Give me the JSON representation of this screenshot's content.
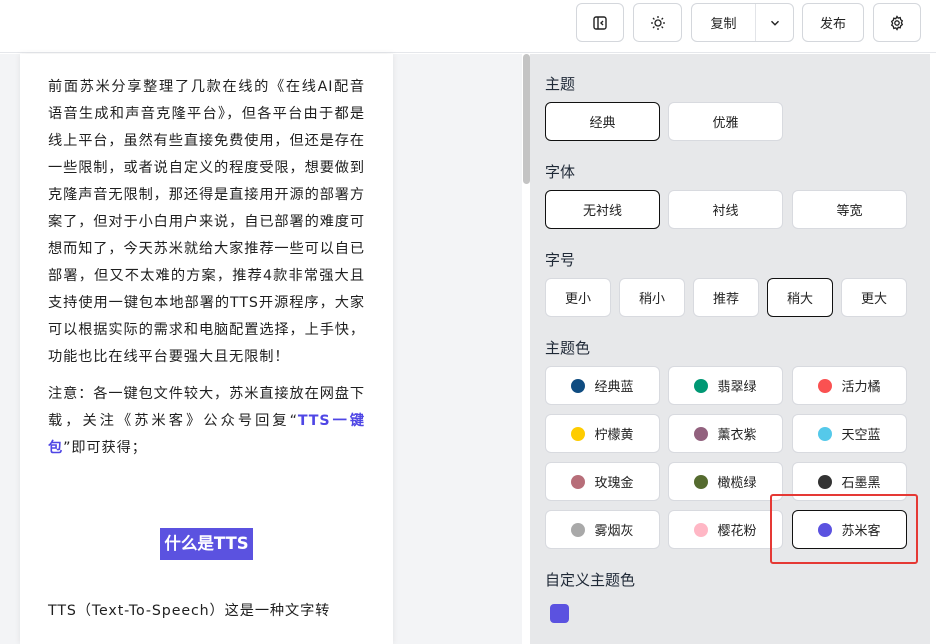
{
  "toolbar": {
    "copy_label": "复制",
    "publish_label": "发布",
    "icons": [
      "sidebar-toggle-icon",
      "sun-icon",
      "chevron-down-icon",
      "gear-icon"
    ]
  },
  "article": {
    "para1": "前面苏米分享整理了几款在线的《在线AI配音语音生成和声音克隆平台》，但各平台由于都是线上平台，虽然有些直接免费使用，但还是存在一些限制，或者说自定义的程度受限，想要做到克隆声音无限制，那还得是直接用开源的部署方案了，但对于小白用户来说，自已部署的难度可想而知了，今天苏米就给大家推荐一些可以自已部署，但又不太难的方案，推荐4款非常强大且支持使用一键包本地部署的TTS开源程序，大家可以根据实际的需求和电脑配置选择，上手快，功能也比在线平台要强大且无限制！",
    "para2_before": "注意：各一键包文件较大，苏米直接放在网盘下载，关注《苏米客》公众号回复“",
    "para2_highlight": "TTS一键包",
    "para2_after": "”即可获得；",
    "heading": "什么是TTS",
    "para3": "TTS（Text-To-Speech）这是一种文字转"
  },
  "panel": {
    "theme_title": "主题",
    "theme_options": [
      {
        "label": "经典",
        "active": true
      },
      {
        "label": "优雅",
        "active": false
      }
    ],
    "font_title": "字体",
    "font_options": [
      {
        "label": "无衬线",
        "active": true
      },
      {
        "label": "衬线",
        "active": false
      },
      {
        "label": "等宽",
        "active": false
      }
    ],
    "size_title": "字号",
    "size_options": [
      {
        "label": "更小",
        "active": false
      },
      {
        "label": "稍小",
        "active": false
      },
      {
        "label": "推荐",
        "active": false
      },
      {
        "label": "稍大",
        "active": true
      },
      {
        "label": "更大",
        "active": false
      }
    ],
    "color_title": "主题色",
    "color_options": [
      {
        "label": "经典蓝",
        "color": "#0f4c81",
        "active": false
      },
      {
        "label": "翡翠绿",
        "color": "#009874",
        "active": false
      },
      {
        "label": "活力橘",
        "color": "#fa5151",
        "active": false
      },
      {
        "label": "柠檬黄",
        "color": "#fecc00",
        "active": false
      },
      {
        "label": "薰衣紫",
        "color": "#92617e",
        "active": false
      },
      {
        "label": "天空蓝",
        "color": "#55c9ea",
        "active": false
      },
      {
        "label": "玫瑰金",
        "color": "#b76e79",
        "active": false
      },
      {
        "label": "橄榄绿",
        "color": "#556b2f",
        "active": false
      },
      {
        "label": "石墨黑",
        "color": "#333333",
        "active": false
      },
      {
        "label": "雾烟灰",
        "color": "#a9a9a9",
        "active": false
      },
      {
        "label": "樱花粉",
        "color": "#ffb7c5",
        "active": false
      },
      {
        "label": "苏米客",
        "color": "#5b52e0",
        "active": true
      }
    ],
    "custom_color_title": "自定义主题色",
    "custom_color": "#5b52e0"
  },
  "colors": {
    "accent": "#5b52e0",
    "highlight_box": "#e53935"
  }
}
